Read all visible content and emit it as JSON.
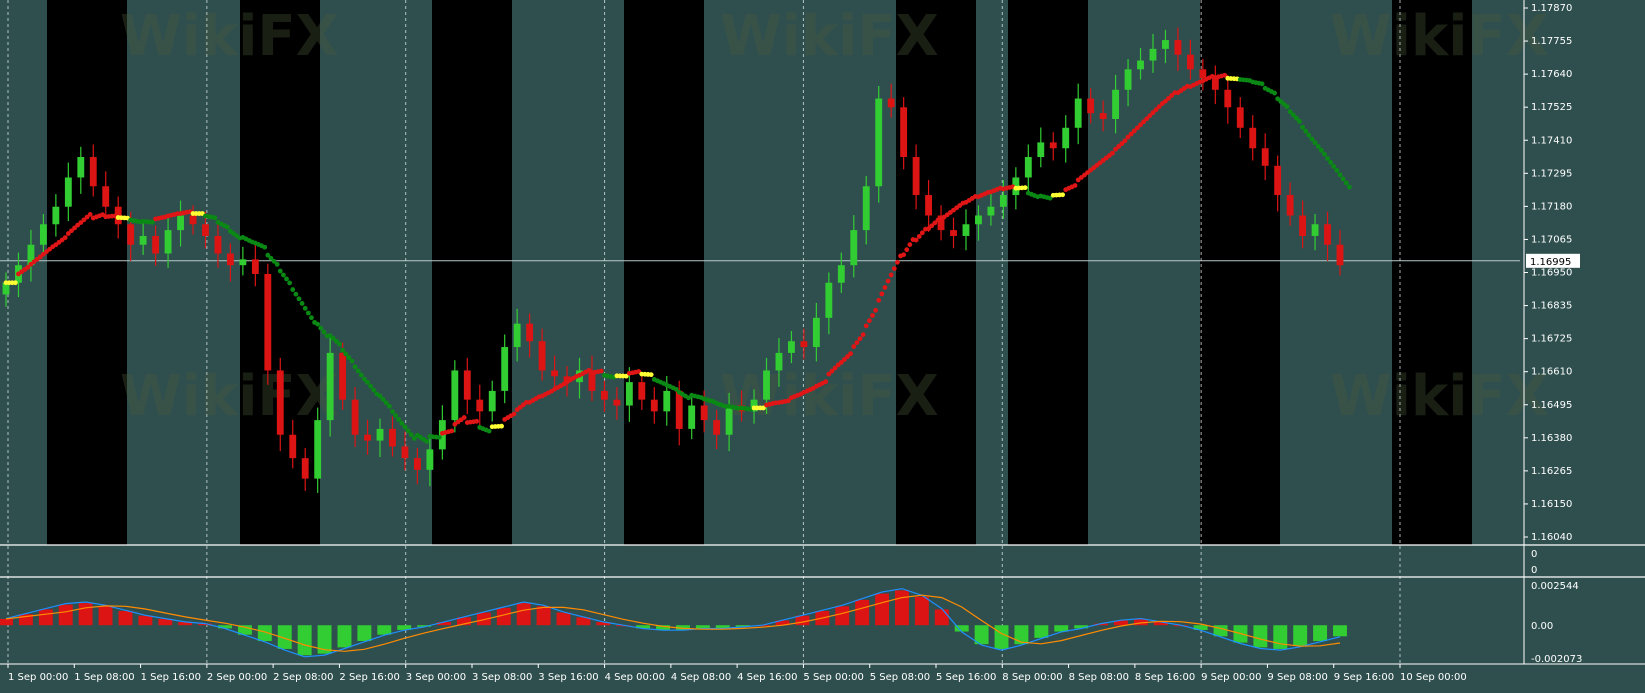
{
  "chart_data": {
    "type": "candlestick",
    "instrument_price_current": "1.16995",
    "main_price_axis": {
      "ticks": [
        "1.17870",
        "1.17755",
        "1.17640",
        "1.17525",
        "1.17410",
        "1.17295",
        "1.17180",
        "1.17065",
        "1.16950",
        "1.16835",
        "1.16725",
        "1.16610",
        "1.16495",
        "1.16380",
        "1.16265",
        "1.16150",
        "1.16040"
      ],
      "range": [
        1.1604,
        1.1787
      ]
    },
    "sub_panel_1": {
      "ticks": [
        "0",
        "0"
      ]
    },
    "sub_panel_2": {
      "ticks": [
        "0.002544",
        "0.00",
        "-0.002073"
      ],
      "range": [
        -0.002073,
        0.002544
      ]
    },
    "time_axis_labels": [
      "1 Sep 00:00",
      "1 Sep 08:00",
      "1 Sep 16:00",
      "2 Sep 00:00",
      "2 Sep 08:00",
      "2 Sep 16:00",
      "3 Sep 00:00",
      "3 Sep 08:00",
      "3 Sep 16:00",
      "4 Sep 00:00",
      "4 Sep 08:00",
      "4 Sep 16:00",
      "5 Sep 00:00",
      "5 Sep 08:00",
      "5 Sep 16:00",
      "8 Sep 00:00",
      "8 Sep 08:00",
      "8 Sep 16:00",
      "9 Sep 00:00",
      "9 Sep 08:00",
      "9 Sep 16:00",
      "10 Sep 00:00"
    ],
    "watermark": "WikiFX",
    "colors": {
      "background": "#2f4f4f",
      "session_band": "#000000",
      "bull": "#32cd32",
      "bear": "#dc1414",
      "ma_red": "#e01616",
      "ma_green": "#0a8a14",
      "ma_yellow": "#ffff33",
      "macd_line": "#1e90ff",
      "signal_line": "#ff8c00"
    },
    "candles_close": [
      1.1692,
      1.1698,
      1.1705,
      1.1712,
      1.1718,
      1.1728,
      1.1735,
      1.1725,
      1.1718,
      1.1712,
      1.1705,
      1.1708,
      1.1702,
      1.171,
      1.1715,
      1.1712,
      1.1708,
      1.1702,
      1.1698,
      1.17,
      1.1695,
      1.1662,
      1.164,
      1.1632,
      1.1625,
      1.1645,
      1.1668,
      1.1652,
      1.164,
      1.1638,
      1.1642,
      1.1636,
      1.1632,
      1.1628,
      1.1635,
      1.1645,
      1.1662,
      1.1652,
      1.1648,
      1.1655,
      1.167,
      1.1678,
      1.1672,
      1.1662,
      1.166,
      1.1658,
      1.1662,
      1.1655,
      1.1652,
      1.165,
      1.1658,
      1.1652,
      1.1648,
      1.1655,
      1.1642,
      1.165,
      1.1645,
      1.164,
      1.165,
      1.1648,
      1.1652,
      1.1662,
      1.1668,
      1.1672,
      1.167,
      1.168,
      1.1692,
      1.1698,
      1.171,
      1.1725,
      1.1755,
      1.1752,
      1.1735,
      1.1722,
      1.1715,
      1.171,
      1.1708,
      1.1712,
      1.1715,
      1.1718,
      1.1722,
      1.1728,
      1.1735,
      1.174,
      1.1738,
      1.1745,
      1.1755,
      1.175,
      1.1748,
      1.1758,
      1.1765,
      1.1768,
      1.1772,
      1.1775,
      1.177,
      1.1765,
      1.1762,
      1.1758,
      1.1752,
      1.1745,
      1.1738,
      1.1732,
      1.1722,
      1.1715,
      1.1708,
      1.1712,
      1.1705,
      1.1698
    ],
    "indicator_values": [
      0.0004,
      0.0007,
      0.001,
      0.0013,
      0.0014,
      0.0012,
      0.0009,
      0.0006,
      0.0004,
      0.0002,
      0.0001,
      -0.0002,
      -0.0006,
      -0.001,
      -0.0015,
      -0.0019,
      -0.0018,
      -0.0014,
      -0.001,
      -0.0006,
      -0.0003,
      -0.0001,
      0.0002,
      0.0005,
      0.0008,
      0.0011,
      0.0014,
      0.0012,
      0.0008,
      0.0005,
      0.0002,
      0.0,
      -0.0002,
      -0.0003,
      -0.0003,
      -0.0002,
      -0.0002,
      -0.0001,
      0.0,
      0.0003,
      0.0006,
      0.0009,
      0.0012,
      0.0016,
      0.002,
      0.0022,
      0.0018,
      0.001,
      -0.0004,
      -0.0012,
      -0.0015,
      -0.0012,
      -0.0008,
      -0.0004,
      -0.0002,
      0.0001,
      0.0003,
      0.0004,
      0.0002,
      0.0,
      -0.0003,
      -0.0007,
      -0.0011,
      -0.0014,
      -0.0015,
      -0.0013,
      -0.001,
      -0.0007
    ]
  }
}
